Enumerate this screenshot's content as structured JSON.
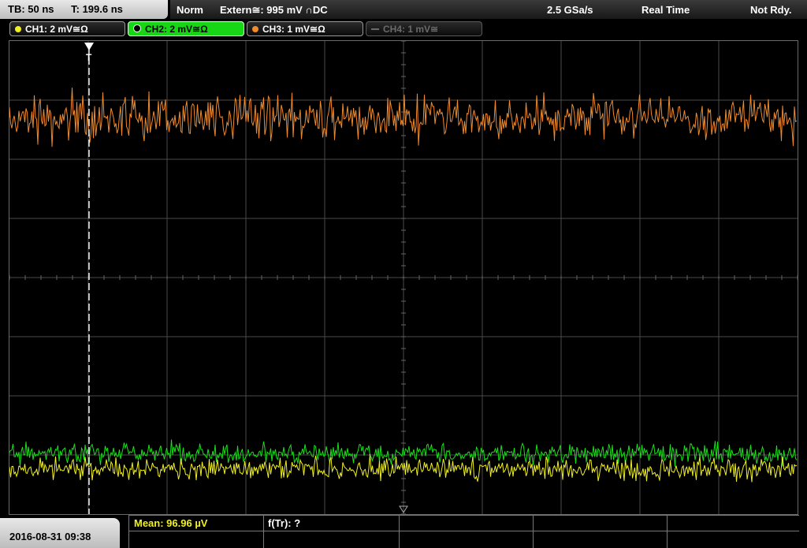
{
  "top_left": {
    "timebase": "TB: 50 ns",
    "trigger_time": "T: 199.6 ns"
  },
  "top_bar": {
    "mode": "Norm",
    "trigger_source": "Extern≅: 995 mV ∩DC",
    "sample_rate": "2.5 GSa/s",
    "acq_mode": "Real Time",
    "status": "Not Rdy."
  },
  "channels": [
    {
      "label": "CH1: 2 mV≅Ω",
      "color": "#f0f020",
      "state": "on"
    },
    {
      "label": "CH2: 2 mV≅Ω",
      "color": "#18e018",
      "state": "selected"
    },
    {
      "label": "CH3: 1 mV≅Ω",
      "color": "#f08a2c",
      "state": "on"
    },
    {
      "label": "CH4: 1 mV≅",
      "color": "#6a6a6a",
      "state": "off"
    }
  ],
  "trigger_marker": "T",
  "datetime": "2016-08-31 09:38",
  "measurements": {
    "mean": "Mean: 96.96 µV",
    "freq": "f(Tr): ?"
  },
  "colors": {
    "ch1": "#f0f020",
    "ch2": "#18e018",
    "ch3": "#f08a2c",
    "grid": "#4a4a4a",
    "background": "#000000"
  }
}
